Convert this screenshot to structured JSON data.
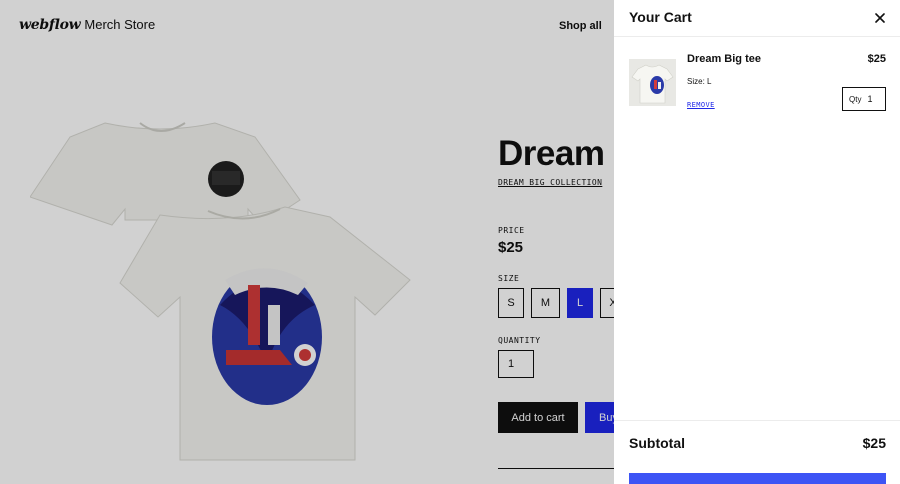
{
  "nav": {
    "logo_text": "webflow",
    "store_name": "Merch Store",
    "shop_all": "Shop all"
  },
  "product": {
    "title": "Dream Big",
    "collection_link": "DREAM BIG COLLECTION",
    "price_label": "PRICE",
    "price": "$25",
    "size_label": "SIZE",
    "sizes": [
      "S",
      "M",
      "L",
      "X"
    ],
    "selected_size": "L",
    "quantity_label": "QUANTITY",
    "quantity": "1",
    "add_to_cart": "Add to cart",
    "buy_now": "Buy"
  },
  "cart": {
    "title": "Your Cart",
    "items": [
      {
        "name": "Dream Big tee",
        "price": "$25",
        "size": "Size: L",
        "remove": "REMOVE",
        "qty_label": "Qty",
        "qty": "1"
      }
    ],
    "subtotal_label": "Subtotal",
    "subtotal_value": "$25",
    "checkout": ""
  },
  "colors": {
    "accent_blue": "#1f28e8",
    "checkout_blue": "#3d54f5",
    "overlay": "rgba(0,0,0,0.18)"
  },
  "icons": {
    "close": "close-icon"
  }
}
